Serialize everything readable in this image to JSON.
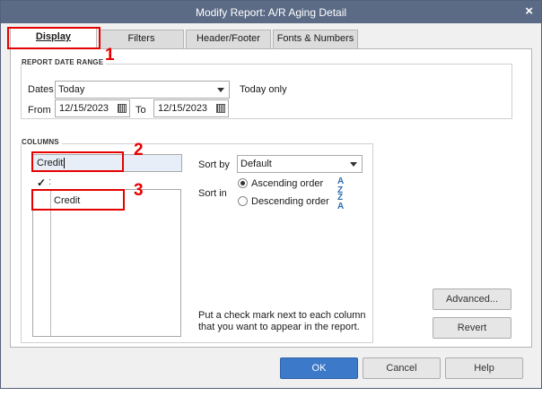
{
  "window": {
    "title": "Modify Report: A/R Aging Detail",
    "close_glyph": "×"
  },
  "tabs": [
    {
      "label": "Display",
      "mnemonic_index": 0
    },
    {
      "label": "Filters",
      "mnemonic_index": 0
    },
    {
      "label": "Header/Footer",
      "mnemonic_index": 0
    },
    {
      "label": "Fonts & Numbers",
      "mnemonic_index": 2
    }
  ],
  "report_date_range": {
    "group_label": "REPORT DATE RANGE",
    "dates_label": "Dates",
    "dates_value": "Today",
    "dates_description": "Today only",
    "from_label": "From",
    "from_value": "12/15/2023",
    "to_label": "To",
    "to_value": "12/15/2023"
  },
  "columns": {
    "group_label": "COLUMNS",
    "search_value": "Credit",
    "check_header": "✓",
    "header_dots": ":",
    "list_items": [
      {
        "checked": false,
        "label": "Credit"
      }
    ],
    "sort_by_label": "Sort by",
    "sort_by_value": "Default",
    "sort_in_label": "Sort in",
    "ascending_label": "Ascending order",
    "descending_label": "Descending order",
    "ascending_selected": true,
    "ascending_icon": "sort-ascending-icon",
    "descending_icon": "sort-descending-icon",
    "help_text_line1": "Put a check mark next to each column",
    "help_text_line2": "that you want to appear in the report."
  },
  "buttons": {
    "advanced": "Advanced...",
    "revert": "Revert",
    "ok": "OK",
    "cancel": "Cancel",
    "help": "Help"
  },
  "annotations": [
    {
      "number": "1",
      "target": "display-tab"
    },
    {
      "number": "2",
      "target": "columns-search-input"
    },
    {
      "number": "3",
      "target": "credit-list-item"
    }
  ],
  "colors": {
    "titlebar": "#5b6b86",
    "annotation_red": "#e60000",
    "primary_button": "#3c79c9"
  }
}
